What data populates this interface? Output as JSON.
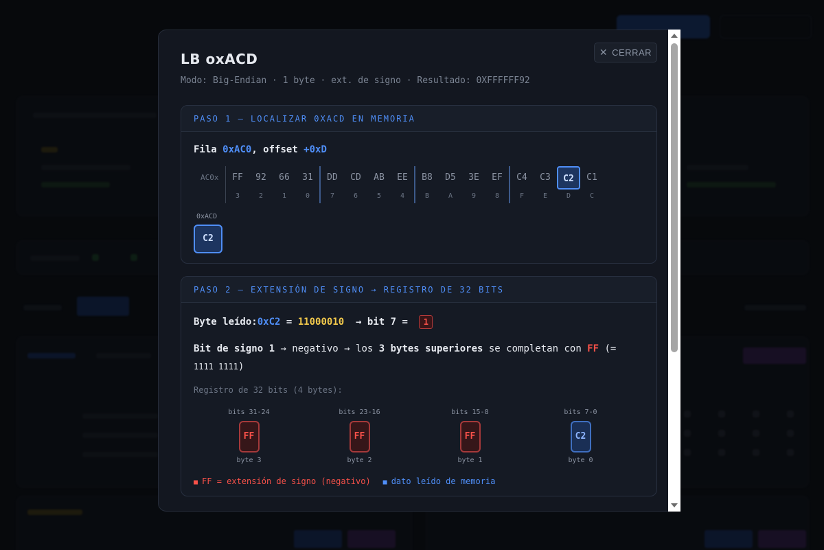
{
  "modal": {
    "title": "LB oxACD",
    "subtitle": "Modo: Big-Endian · 1 byte · ext. de signo · Resultado: 0XFFFFFF92",
    "close_label": "CERRAR",
    "close_icon": "close-icon"
  },
  "step1": {
    "header": "PASO 1 — LOCALIZAR 0XACD EN MEMORIA",
    "fila_prefix": "Fila ",
    "fila_addr": "0xAC0",
    "fila_mid": ", offset ",
    "fila_offset": "+0xD",
    "row_label": "AC0x",
    "groups": [
      [
        {
          "byte": "FF",
          "idx": "3"
        },
        {
          "byte": "92",
          "idx": "2"
        },
        {
          "byte": "66",
          "idx": "1"
        },
        {
          "byte": "31",
          "idx": "0"
        }
      ],
      [
        {
          "byte": "DD",
          "idx": "7"
        },
        {
          "byte": "CD",
          "idx": "6"
        },
        {
          "byte": "AB",
          "idx": "5"
        },
        {
          "byte": "EE",
          "idx": "4"
        }
      ],
      [
        {
          "byte": "B8",
          "idx": "B"
        },
        {
          "byte": "D5",
          "idx": "A"
        },
        {
          "byte": "3E",
          "idx": "9"
        },
        {
          "byte": "EF",
          "idx": "8"
        }
      ],
      [
        {
          "byte": "C4",
          "idx": "F"
        },
        {
          "byte": "C3",
          "idx": "E"
        },
        {
          "byte": "C2",
          "idx": "D",
          "selected": true
        },
        {
          "byte": "C1",
          "idx": "C"
        }
      ]
    ],
    "addr_label": "0xACD",
    "addr_value": "C2"
  },
  "step2": {
    "header": "PASO 2 — EXTENSIÓN DE SIGNO → REGISTRO DE 32 BITS",
    "read_label": "Byte leído: ",
    "read_hex": "0xC2",
    "eq": " = ",
    "read_bin": "11000010",
    "arrow_bit": "  → bit 7 = ",
    "bit_value": "1",
    "sign_a": "Bit de signo ",
    "sign_b": "1",
    "sign_c": " → negativo → los ",
    "sign_d": "3 bytes superiores",
    "sign_e": " se completan con ",
    "sign_f": "FF",
    "sign_g": " (= ",
    "sign_h": "1111 1111",
    "sign_i": ")",
    "reg_title": "Registro de 32 bits (4 bytes):",
    "register": [
      {
        "bits": "bits 31-24",
        "value": "FF",
        "byte": "byte 3",
        "kind": "ext"
      },
      {
        "bits": "bits 23-16",
        "value": "FF",
        "byte": "byte 2",
        "kind": "ext"
      },
      {
        "bits": "bits 15-8",
        "value": "FF",
        "byte": "byte 1",
        "kind": "ext"
      },
      {
        "bits": "bits 7-0",
        "value": "C2",
        "byte": "byte 0",
        "kind": "mem"
      }
    ],
    "legend_ext": "FF = extensión de signo (negativo)",
    "legend_mem": "dato leído de memoria",
    "colors": {
      "ext": "#f85149",
      "mem": "#4f8ef7"
    }
  }
}
